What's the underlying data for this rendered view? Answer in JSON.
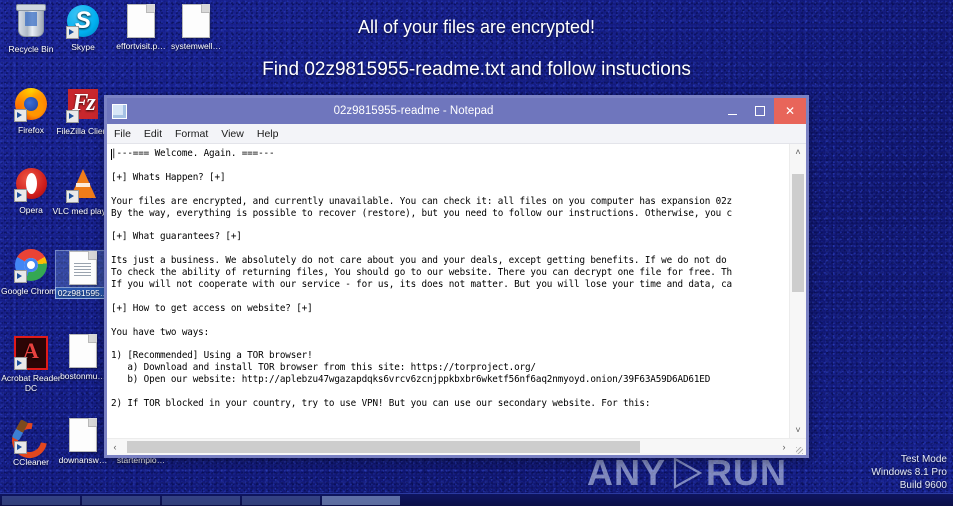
{
  "banner": {
    "line1": "All of your files are encrypted!",
    "line2": "Find 02z9815955-readme.txt and follow instuctions"
  },
  "desktop": {
    "icons": [
      {
        "label": "Recycle Bin",
        "icon": "recycle-bin-icon",
        "selected": false
      },
      {
        "label": "Skype",
        "icon": "skype-icon",
        "selected": false
      },
      {
        "label": "effortvisit.p…",
        "icon": "file-icon",
        "selected": false
      },
      {
        "label": "systemwell…",
        "icon": "file-icon",
        "selected": false
      },
      {
        "label": "Firefox",
        "icon": "firefox-icon",
        "selected": false
      },
      {
        "label": "FileZilla Client",
        "icon": "filezilla-icon",
        "selected": false
      },
      {
        "label": "Opera",
        "icon": "opera-icon",
        "selected": false
      },
      {
        "label": "VLC med player",
        "icon": "vlc-icon",
        "selected": false
      },
      {
        "label": "Google Chrome",
        "icon": "chrome-icon",
        "selected": false
      },
      {
        "label": "02z981595…",
        "icon": "text-file-icon",
        "selected": true
      },
      {
        "label": "Acrobat Reader DC",
        "icon": "acrobat-icon",
        "selected": false
      },
      {
        "label": "bostonmu…",
        "icon": "file-icon",
        "selected": false
      },
      {
        "label": "CCleaner",
        "icon": "ccleaner-icon",
        "selected": false
      },
      {
        "label": "downansw…",
        "icon": "file-icon",
        "selected": false
      },
      {
        "label": "startemplo…",
        "icon": "file-icon",
        "selected": false
      }
    ]
  },
  "notepad": {
    "title": "02z9815955-readme - Notepad",
    "minimize_label": "–",
    "maximize_label": "❑",
    "close_label": "✕",
    "menu": [
      "File",
      "Edit",
      "Format",
      "View",
      "Help"
    ],
    "scroll_up_label": "˄",
    "scroll_down_label": "˅",
    "scroll_left_label": "‹",
    "scroll_right_label": "›",
    "content": "|---=== Welcome. Again. ===---\n\n[+] Whats Happen? [+]\n\nYour files are encrypted, and currently unavailable. You can check it: all files on you computer has expansion 02z\nBy the way, everything is possible to recover (restore), but you need to follow our instructions. Otherwise, you c\n\n[+] What guarantees? [+]\n\nIts just a business. We absolutely do not care about you and your deals, except getting benefits. If we do not do \nTo check the ability of returning files, You should go to our website. There you can decrypt one file for free. Th\nIf you will not cooperate with our service - for us, its does not matter. But you will lose your time and data, ca\n\n[+] How to get access on website? [+]\n\nYou have two ways:\n\n1) [Recommended] Using a TOR browser!\n   a) Download and install TOR browser from this site: https://torproject.org/\n   b) Open our website: http://aplebzu47wgazapdqks6vrcv6zcnjppkbxbr6wketf56nf6aq2nmyoyd.onion/39F63A59D6AD61ED\n\n2) If TOR blocked in your country, try to use VPN! But you can use our secondary website. For this:"
  },
  "watermark": {
    "left_text": "ANY",
    "right_text": "RUN"
  },
  "testmode": {
    "line1": "Test Mode",
    "line2": "Windows 8.1 Pro",
    "line3": "Build 9600"
  },
  "colors": {
    "desktop_blue": "#151b8c",
    "titlebar": "#6f76bd",
    "close_red": "#e8655a",
    "window_border": "#7b82c4"
  }
}
